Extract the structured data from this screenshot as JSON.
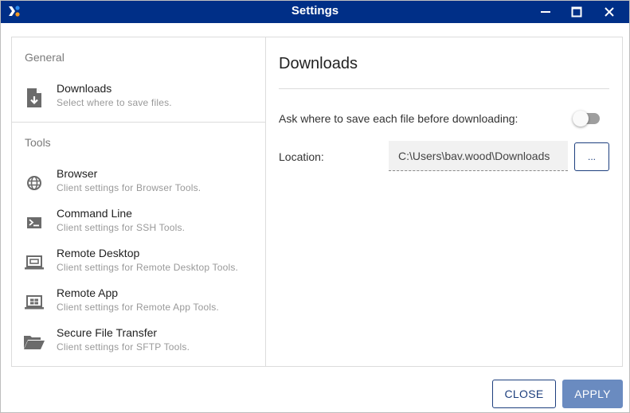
{
  "window": {
    "title": "Settings",
    "controls": {
      "minimize": "minimize",
      "maximize": "maximize",
      "close": "close"
    }
  },
  "sidebar": {
    "sections": [
      {
        "label": "General",
        "items": [
          {
            "title": "Downloads",
            "description": "Select where to save files.",
            "icon": "file-download-icon"
          }
        ]
      },
      {
        "label": "Tools",
        "items": [
          {
            "title": "Browser",
            "description": "Client settings for Browser Tools.",
            "icon": "globe-icon"
          },
          {
            "title": "Command Line",
            "description": "Client settings for SSH Tools.",
            "icon": "terminal-icon"
          },
          {
            "title": "Remote Desktop",
            "description": "Client settings for Remote Desktop Tools.",
            "icon": "laptop-icon"
          },
          {
            "title": "Remote App",
            "description": "Client settings for Remote App Tools.",
            "icon": "laptop-app-icon"
          },
          {
            "title": "Secure File Transfer",
            "description": "Client settings for SFTP Tools.",
            "icon": "folder-open-icon"
          }
        ]
      }
    ]
  },
  "content": {
    "title": "Downloads",
    "ask_label": "Ask where to save each file before downloading:",
    "ask_enabled": false,
    "location_label": "Location:",
    "location_value": "C:\\Users\\bav.wood\\Downloads",
    "browse_label": "..."
  },
  "footer": {
    "close_label": "CLOSE",
    "apply_label": "APPLY"
  },
  "colors": {
    "titlebar": "#002f87",
    "accent": "#1d3f7e",
    "apply_disabled": "#6a8bc0"
  }
}
